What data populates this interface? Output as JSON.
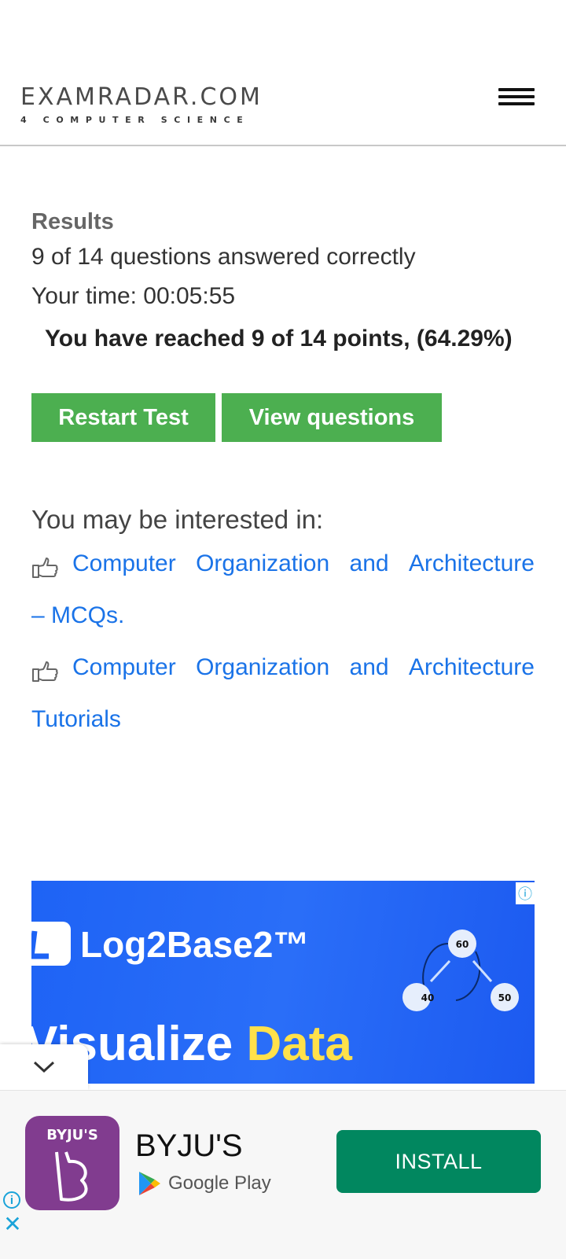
{
  "header": {
    "logo_main": "EXAMRADAR.COM",
    "logo_sub": "4 COMPUTER SCIENCE",
    "menu_icon": "hamburger-menu-icon"
  },
  "results": {
    "title": "Results",
    "answered": "9 of 14 questions answered correctly",
    "time": "Your time: 00:05:55",
    "points": "You have reached 9 of 14 points, (64.29%)",
    "restart_label": "Restart Test",
    "view_label": "View questions"
  },
  "related": {
    "heading": "You may be interested in:",
    "items": [
      {
        "icon": "thumbs-up-outline-icon",
        "line1_words": [
          "Computer",
          "Organization",
          "and",
          "Architecture"
        ],
        "line2": "– MCQs."
      },
      {
        "icon": "thumbs-up-outline-icon",
        "line1_words": [
          "Computer",
          "Organization",
          "and",
          "Architecture"
        ],
        "line2": "Tutorials"
      }
    ]
  },
  "ad_banner": {
    "brand": "Log2Base2™",
    "tagline_part1": "Visualize",
    "tagline_part2": "Data",
    "node_labels": [
      "60",
      "40",
      "50"
    ],
    "info_icon": "info-icon"
  },
  "install_ad": {
    "icon_text": "BYJU'S",
    "app_name": "BYJU'S",
    "store": "Google Play",
    "install_label": "INSTALL",
    "collapse_icon": "chevron-down-icon"
  },
  "colors": {
    "button_green": "#4caf50",
    "link_blue": "#1a73e8",
    "ad_blue": "#1e63f5",
    "install_green": "#01875f",
    "byjus_purple": "#813c8f"
  }
}
